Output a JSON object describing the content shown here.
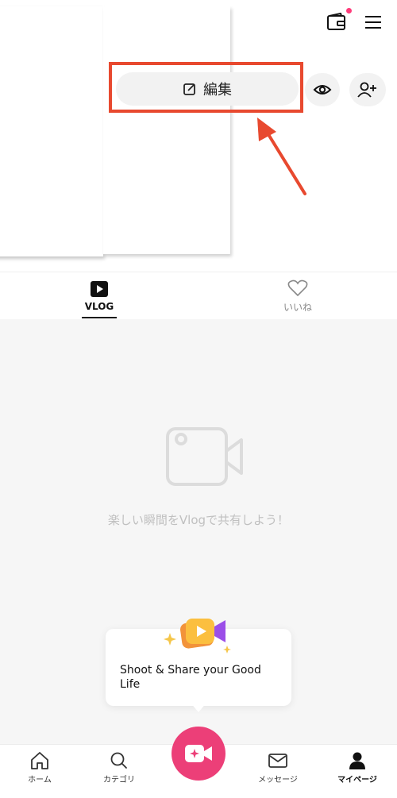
{
  "header": {
    "edit_label": "編集",
    "icons": [
      "wallet-icon",
      "menu-icon",
      "edit-icon",
      "eye-icon",
      "add-user-icon"
    ],
    "notification_dot_color": "#ff3b7a"
  },
  "annotation": {
    "highlight_color": "#e8492f"
  },
  "tabs": [
    {
      "label": "VLOG",
      "icon": "play-icon",
      "active": true
    },
    {
      "label": "いいね",
      "icon": "heart-icon",
      "active": false
    }
  ],
  "empty_state": {
    "icon": "video-camera-icon",
    "message": "楽しい瞬間をVlogで共有しよう！"
  },
  "tooltip": {
    "text": "Shoot & Share your Good Life",
    "art": "video-camera-sparkle-icon"
  },
  "bottom_nav": [
    {
      "label": "ホーム",
      "icon": "home-icon"
    },
    {
      "label": "カテゴリ",
      "icon": "search-icon"
    },
    {
      "label": "メッセージ",
      "icon": "mail-icon"
    },
    {
      "label": "マイページ",
      "icon": "person-icon",
      "active": true
    }
  ],
  "record_button": {
    "icon": "video-sparkle-icon",
    "color": "#ec3f78"
  }
}
